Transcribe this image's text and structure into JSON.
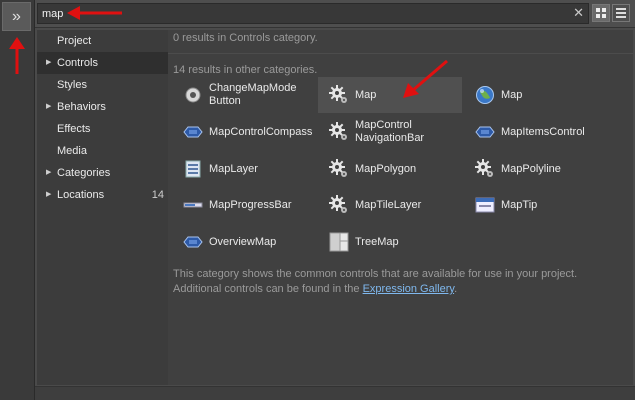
{
  "search": {
    "value": "map",
    "clear_glyph": "✕"
  },
  "expand_glyph": "»",
  "sidebar": {
    "items": [
      {
        "label": "Project",
        "has_children": false,
        "selected": false,
        "count": ""
      },
      {
        "label": "Controls",
        "has_children": true,
        "selected": true,
        "count": ""
      },
      {
        "label": "Styles",
        "has_children": false,
        "selected": false,
        "count": ""
      },
      {
        "label": "Behaviors",
        "has_children": true,
        "selected": false,
        "count": ""
      },
      {
        "label": "Effects",
        "has_children": false,
        "selected": false,
        "count": ""
      },
      {
        "label": "Media",
        "has_children": false,
        "selected": false,
        "count": ""
      },
      {
        "label": "Categories",
        "has_children": true,
        "selected": false,
        "count": ""
      },
      {
        "label": "Locations",
        "has_children": true,
        "selected": false,
        "count": "14"
      }
    ]
  },
  "results": {
    "in_category": "0 results in Controls category.",
    "other": "14 results in other categories.",
    "items": [
      {
        "label": "ChangeMapMode\nButton",
        "icon": "radio-button-icon"
      },
      {
        "label": "Map",
        "icon": "gear-icon"
      },
      {
        "label": "Map",
        "icon": "globe-icon"
      },
      {
        "label": "MapControlCompass",
        "icon": "control-diamond-icon"
      },
      {
        "label": "MapControl\nNavigationBar",
        "icon": "gear-icon"
      },
      {
        "label": "MapItemsControl",
        "icon": "control-diamond-icon"
      },
      {
        "label": "MapLayer",
        "icon": "panel-icon"
      },
      {
        "label": "MapPolygon",
        "icon": "gear-icon"
      },
      {
        "label": "MapPolyline",
        "icon": "gear-icon"
      },
      {
        "label": "MapProgressBar",
        "icon": "progress-bar-icon"
      },
      {
        "label": "MapTileLayer",
        "icon": "gear-icon"
      },
      {
        "label": "MapTip",
        "icon": "window-icon"
      },
      {
        "label": "OverviewMap",
        "icon": "control-diamond-icon"
      },
      {
        "label": "TreeMap",
        "icon": "treemap-icon"
      }
    ]
  },
  "description": {
    "line1": "This category shows the common controls that are available for use in your project.",
    "line2_prefix": "Additional controls can be found in the ",
    "link": "Expression Gallery",
    "line2_suffix": "."
  },
  "colors": {
    "arrow": "#e01010",
    "link": "#7fb8ee",
    "muted_text": "#9a9a9a"
  }
}
